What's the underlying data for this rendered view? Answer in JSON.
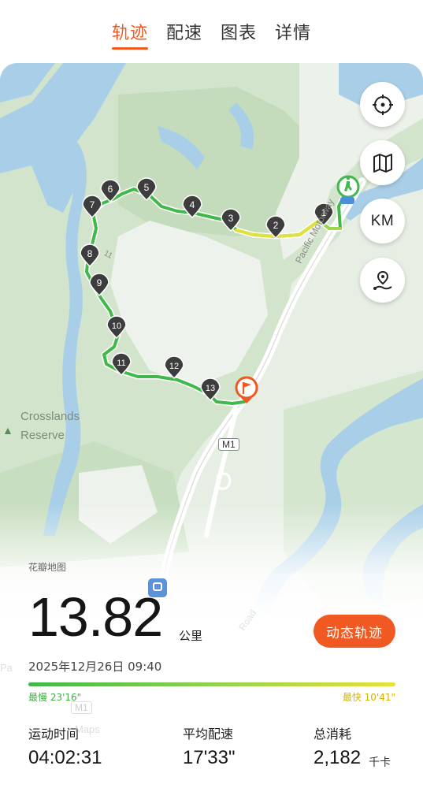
{
  "tabs": [
    {
      "label": "轨迹",
      "active": true
    },
    {
      "label": "配速",
      "active": false
    },
    {
      "label": "图表",
      "active": false
    },
    {
      "label": "详情",
      "active": false
    }
  ],
  "map": {
    "labels": {
      "crosslands": "Crosslands",
      "reserve": "Reserve",
      "motorway": "Pacific Motorway",
      "m1": "M1",
      "m1_faded": "M1",
      "track": "11",
      "ghost_pa": "Pa",
      "ghost_maps": "Maps",
      "ghost_road": "Road"
    },
    "watermark": "花瓣地图",
    "controls": {
      "locate": "crosshair-icon",
      "layers": "map-icon",
      "km": "KM",
      "route": "route-icon"
    },
    "markers": [
      "1",
      "2",
      "3",
      "4",
      "5",
      "6",
      "7",
      "8",
      "9",
      "10",
      "11",
      "12",
      "13"
    ],
    "colors": {
      "water": "#a9cfe8",
      "park": "#cfe1c9",
      "route_fast": "#e8e23a",
      "route_slow": "#41b84a",
      "accent": "#f05a22"
    }
  },
  "summary": {
    "distance": "13.82",
    "distance_unit": "公里",
    "dynamic_button": "动态轨迹",
    "date": "2025年12月26日 09:40",
    "pace_slowest": "最慢 23'16\"",
    "pace_fastest": "最快 10'41\""
  },
  "stats": [
    {
      "label": "运动时间",
      "value": "04:02:31",
      "unit": ""
    },
    {
      "label": "平均配速",
      "value": "17'33\"",
      "unit": ""
    },
    {
      "label": "总消耗",
      "value": "2,182",
      "unit": "千卡"
    }
  ]
}
